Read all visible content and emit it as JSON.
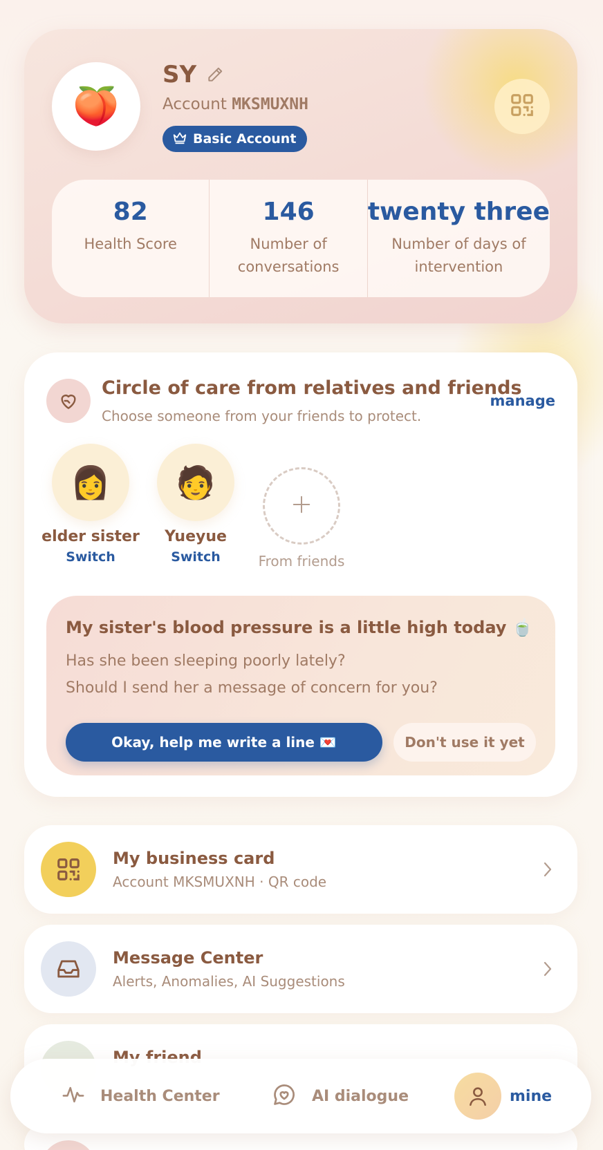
{
  "profile": {
    "avatar_emoji": "🍑",
    "name": "SY",
    "account_label": "Account",
    "account_id": "MKSMUXNH",
    "badge": "Basic Account",
    "stats": [
      {
        "value": "82",
        "label": "Health Score"
      },
      {
        "value": "146",
        "label": "Number of conversations"
      },
      {
        "value": "twenty three",
        "label": "Number of days of intervention"
      }
    ]
  },
  "care_circle": {
    "title": "Circle of care from relatives and friends",
    "subtitle": "Choose someone from your friends to protect.",
    "manage": "manage",
    "members": [
      {
        "emoji": "👩",
        "name": "elder sister",
        "action": "Switch"
      },
      {
        "emoji": "🧑",
        "name": "Yueyue",
        "action": "Switch"
      }
    ],
    "add_label": "From friends",
    "alert": {
      "title": "My sister's blood pressure is a little high today 🍵",
      "line1": "Has she been sleeping poorly lately?",
      "line2": "Should I send her a message of concern for you?",
      "primary_button": "Okay, help me write a line 💌",
      "secondary_button": "Don't use it yet"
    }
  },
  "menu": [
    {
      "title": "My business card",
      "subtitle": "Account MKSMUXNH · QR code",
      "icon": "qr-code-icon",
      "icon_bg": "#f2cf5b"
    },
    {
      "title": "Message Center",
      "subtitle": "Alerts, Anomalies, AI Suggestions",
      "icon": "inbox-icon",
      "icon_bg": "#e2e7f1"
    },
    {
      "title": "My friend",
      "subtitle": "",
      "icon": "friends-icon",
      "icon_bg": "#e6ebe0"
    }
  ],
  "nav": {
    "items": [
      {
        "label": "Health Center",
        "icon": "pulse-icon"
      },
      {
        "label": "AI dialogue",
        "icon": "chat-heart-icon"
      },
      {
        "label": "mine",
        "icon": "user-icon",
        "active": true
      }
    ]
  },
  "colors": {
    "accent_blue": "#2a5aa0",
    "text_brown": "#8a5a40",
    "muted_brown": "#a07a64",
    "card_pink": "#f4dcd6",
    "glow_yellow": "#f7dc82"
  }
}
